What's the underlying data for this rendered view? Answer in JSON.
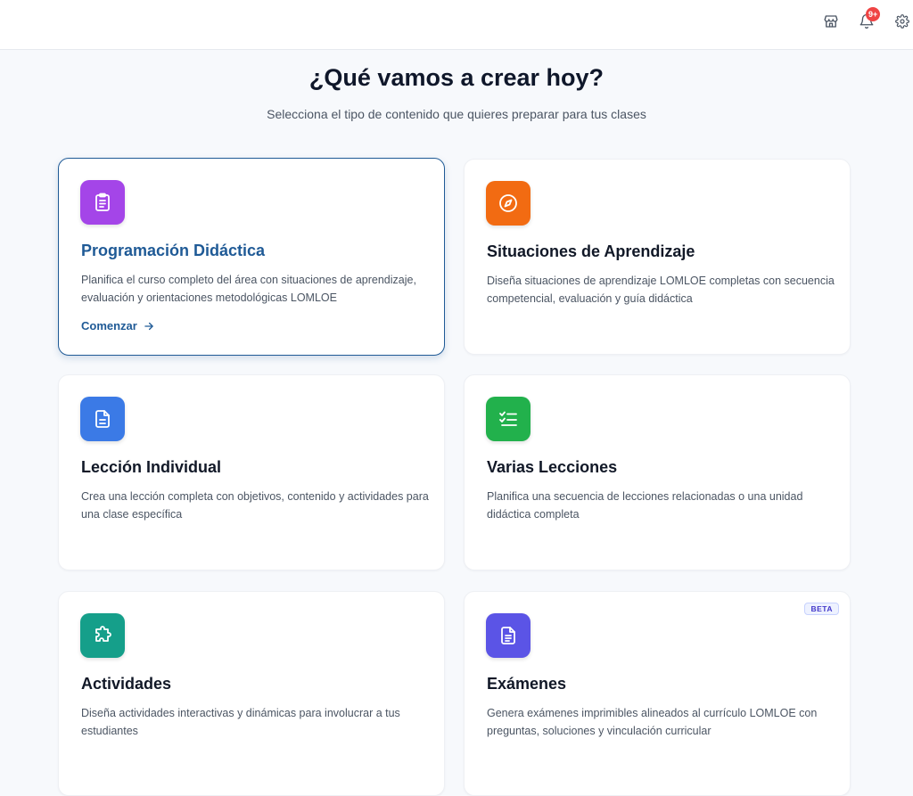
{
  "header": {
    "notification_count": "9+"
  },
  "hero": {
    "title": "¿Qué vamos a crear hoy?",
    "subtitle": "Selecciona el tipo de contenido que quieres preparar para tus clases"
  },
  "cards": [
    {
      "title": "Programación Didáctica",
      "description": "Planifica el curso completo del área con situaciones de aprendizaje, evaluación y orientaciones metodológicas LOMLOE",
      "cta": "Comenzar",
      "icon": "clipboard-icon",
      "color": "#a445e8",
      "selected": true
    },
    {
      "title": "Situaciones de Aprendizaje",
      "description": "Diseña situaciones de aprendizaje LOMLOE completas con secuencia competencial, evaluación y guía didáctica",
      "icon": "compass-icon",
      "color": "#f26b12"
    },
    {
      "title": "Lección Individual",
      "description": "Crea una lección completa con objetivos, contenido y actividades para una clase específica",
      "icon": "document-icon",
      "color": "#3b7ae6"
    },
    {
      "title": "Varias Lecciones",
      "description": "Planifica una secuencia de lecciones relacionadas o una unidad didáctica completa",
      "icon": "checklist-icon",
      "color": "#22b14c"
    },
    {
      "title": "Actividades",
      "description": "Diseña actividades interactivas y dinámicas para involucrar a tus estudiantes",
      "icon": "puzzle-icon",
      "color": "#159f8a"
    },
    {
      "title": "Exámenes",
      "description": "Genera exámenes imprimibles alineados al currículo LOMLOE con preguntas, soluciones y vinculación curricular",
      "icon": "exam-document-icon",
      "color": "#5b54e6",
      "badge": "BETA"
    }
  ]
}
